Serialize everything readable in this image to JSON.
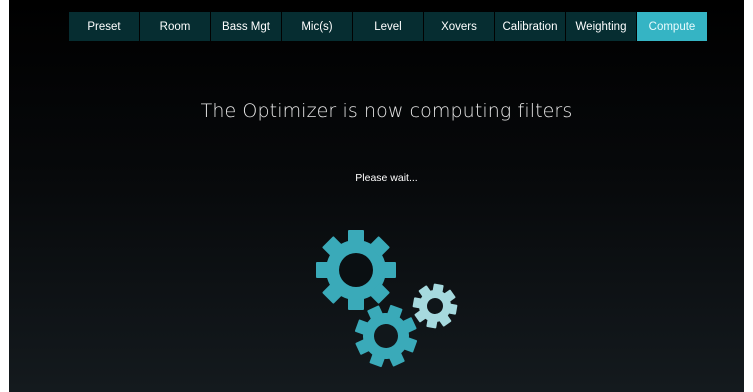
{
  "nav": {
    "tabs": [
      {
        "label": "Preset"
      },
      {
        "label": "Room"
      },
      {
        "label": "Bass Mgt"
      },
      {
        "label": "Mic(s)"
      },
      {
        "label": "Level"
      },
      {
        "label": "Xovers"
      },
      {
        "label": "Calibration"
      },
      {
        "label": "Weighting"
      },
      {
        "label": "Compute"
      }
    ],
    "active": "Compute"
  },
  "main": {
    "title": "The Optimizer is now computing filters",
    "status": "Please wait..."
  },
  "colors": {
    "accent": "#35b4c4",
    "tab_bg": "#062d31",
    "gear_large": "#3aaab9",
    "gear_small": "#a6d9de"
  },
  "icons": {
    "loading": "gears-icon"
  }
}
